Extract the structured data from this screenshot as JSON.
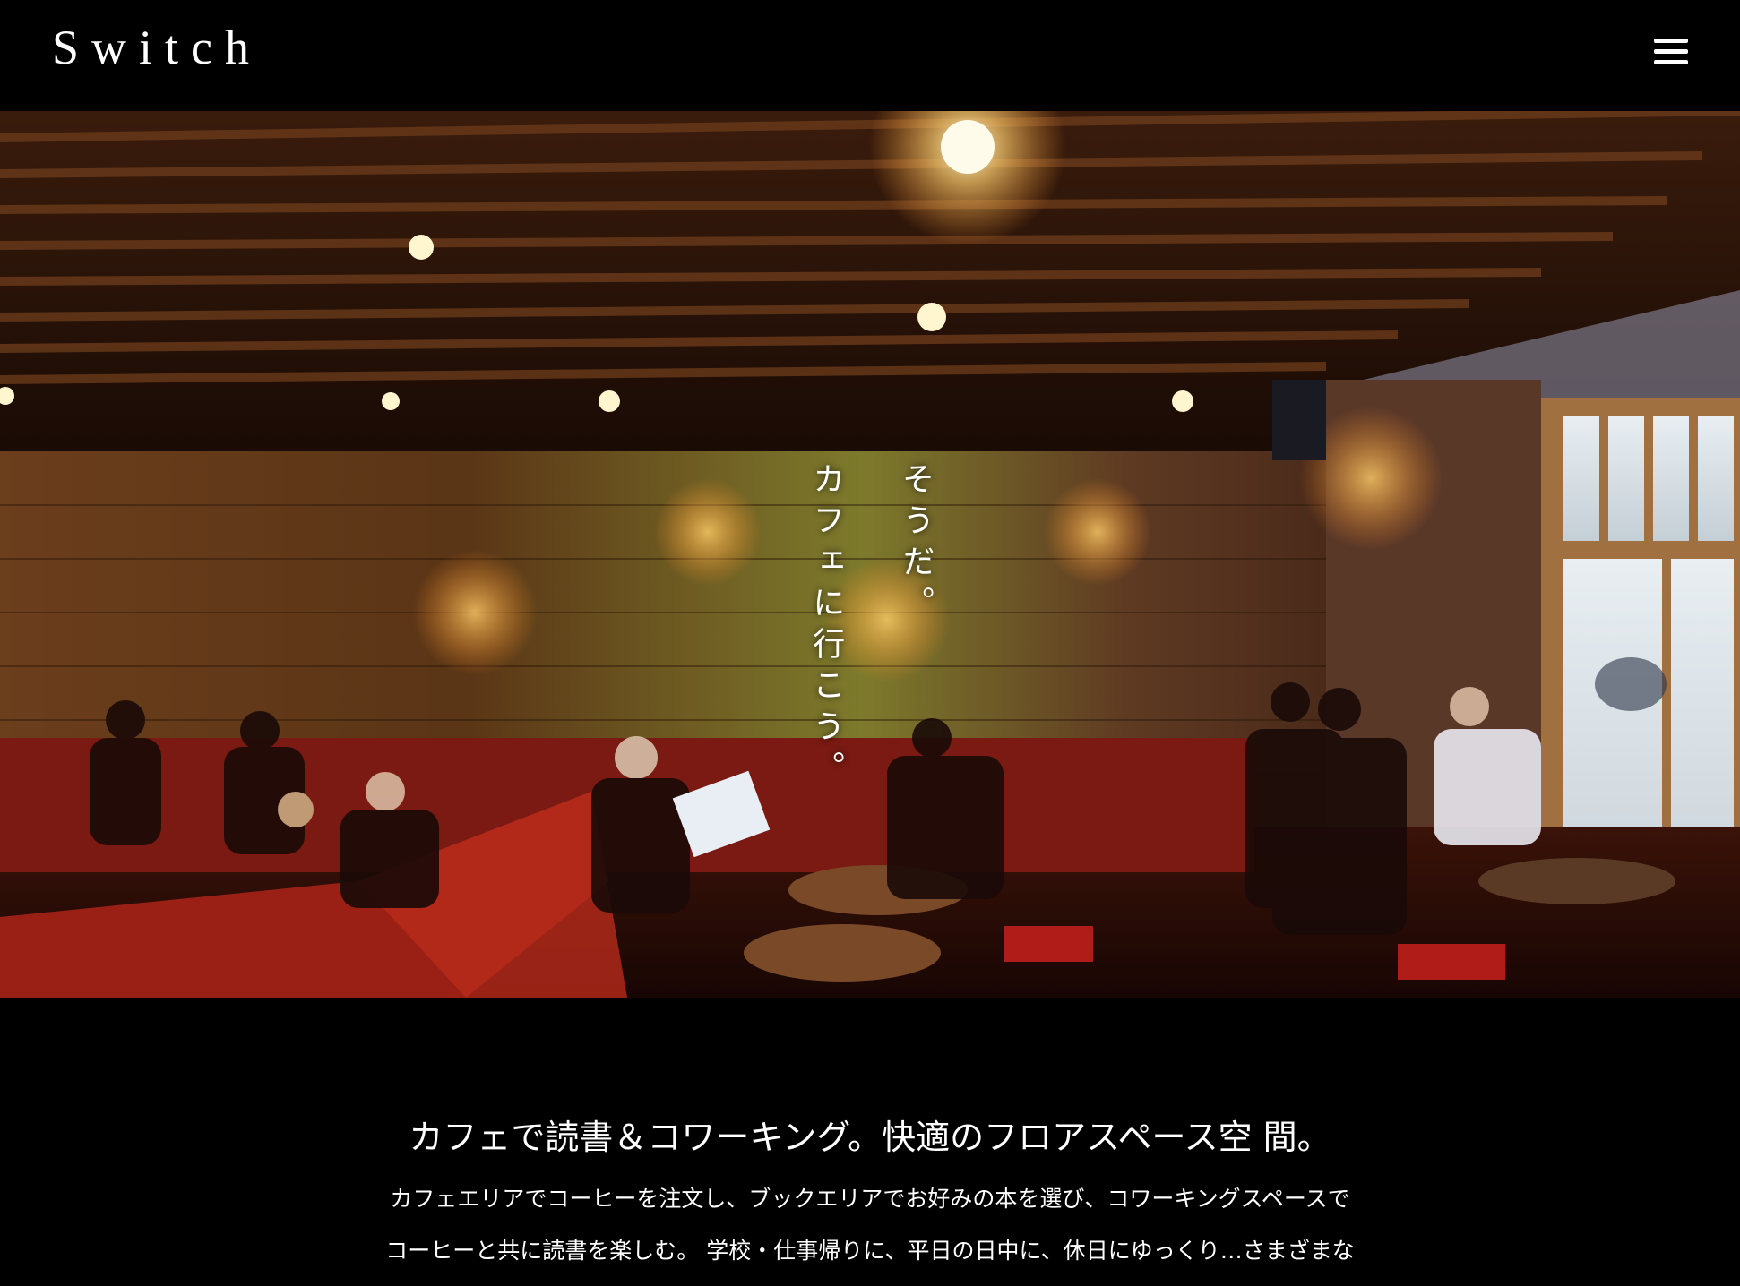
{
  "header": {
    "logo": "Switch",
    "menu_icon": "hamburger-menu-icon"
  },
  "hero": {
    "catch_line1": "そうだ。",
    "catch_line2": "カフェに行こう。"
  },
  "intro": {
    "title": "カフェで読書＆コワーキング。快適のフロアスペース空 間。",
    "text_line1": "カフェエリアでコーヒーを注文し、ブックエリアでお好みの本を選び、コワーキングスペースで",
    "text_line2": "コーヒーと共に読書を楽しむ。 学校・仕事帰りに、平日の日中に、休日にゆっくり…さまざまな"
  }
}
